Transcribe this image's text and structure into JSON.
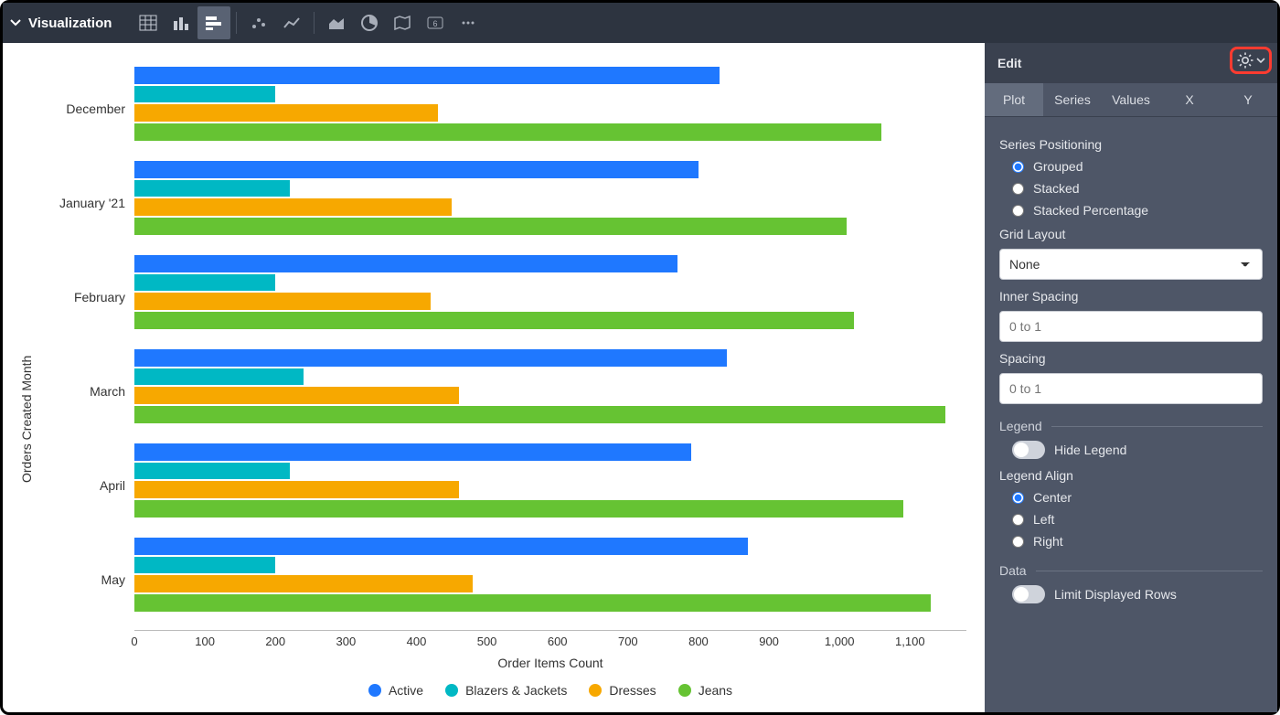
{
  "toolbar": {
    "title": "Visualization"
  },
  "chart_data": {
    "type": "bar",
    "orientation": "horizontal",
    "grouped": true,
    "categories": [
      "December",
      "January '21",
      "February",
      "March",
      "April",
      "May"
    ],
    "series": [
      {
        "name": "Active",
        "color": "#1f78ff",
        "values": [
          830,
          800,
          770,
          840,
          790,
          870
        ]
      },
      {
        "name": "Blazers & Jackets",
        "color": "#00b8c4",
        "values": [
          200,
          220,
          200,
          240,
          220,
          200
        ]
      },
      {
        "name": "Dresses",
        "color": "#f7a800",
        "values": [
          430,
          450,
          420,
          460,
          460,
          480
        ]
      },
      {
        "name": "Jeans",
        "color": "#66c333",
        "values": [
          1060,
          1010,
          1020,
          1150,
          1090,
          1130
        ]
      }
    ],
    "xlabel": "Order Items Count",
    "ylabel": "Orders Created Month",
    "xlim": [
      0,
      1180
    ],
    "ticks": [
      0,
      100,
      200,
      300,
      400,
      500,
      600,
      700,
      800,
      900,
      1000,
      1100
    ]
  },
  "xtick_labels": [
    "0",
    "100",
    "200",
    "300",
    "400",
    "500",
    "600",
    "700",
    "800",
    "900",
    "1,000",
    "1,100"
  ],
  "panel": {
    "title": "Edit",
    "tabs": [
      "Plot",
      "Series",
      "Values",
      "X",
      "Y"
    ],
    "series_pos_heading": "Series Positioning",
    "series_pos": {
      "grouped": "Grouped",
      "stacked": "Stacked",
      "stacked_pct": "Stacked Percentage"
    },
    "grid_layout_heading": "Grid Layout",
    "grid_layout_value": "None",
    "inner_spacing_heading": "Inner Spacing",
    "inner_spacing_placeholder": "0 to 1",
    "spacing_heading": "Spacing",
    "spacing_placeholder": "0 to 1",
    "legend_heading": "Legend",
    "hide_legend_label": "Hide Legend",
    "legend_align_heading": "Legend Align",
    "legend_align": {
      "center": "Center",
      "left": "Left",
      "right": "Right"
    },
    "data_heading": "Data",
    "limit_rows_label": "Limit Displayed Rows"
  }
}
